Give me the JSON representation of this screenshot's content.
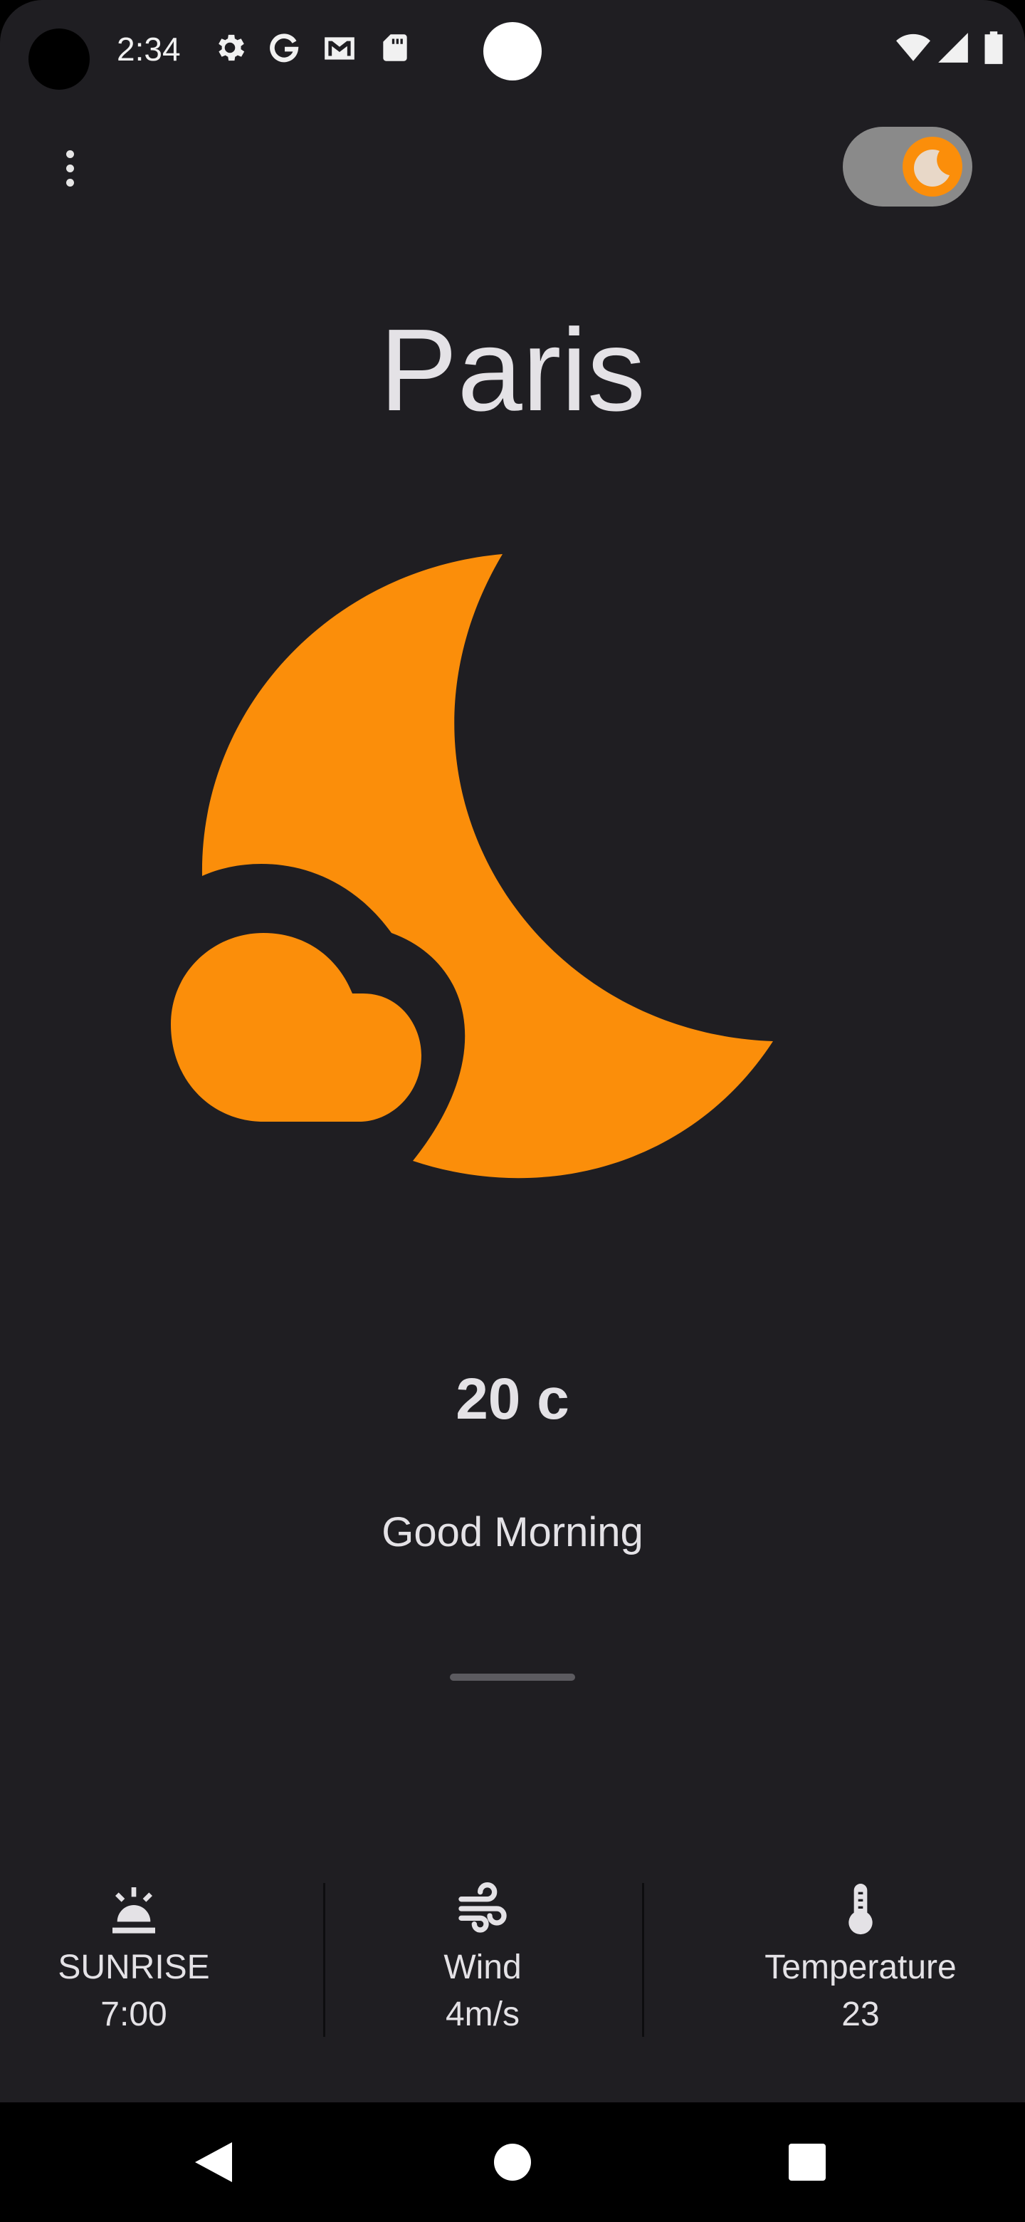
{
  "status_bar": {
    "time": "2:34",
    "icons": [
      "settings-icon",
      "google-icon",
      "gmail-icon",
      "sd-card-icon",
      "wifi-icon",
      "signal-icon",
      "battery-icon"
    ]
  },
  "top_bar": {
    "menu_icon": "more-vert-icon",
    "theme_toggle": {
      "state": "dark",
      "icon": "moon-cloud-icon"
    }
  },
  "weather": {
    "city": "Paris",
    "illustration": "moon-cloud-icon",
    "temperature": "20 c",
    "greeting": "Good Morning"
  },
  "details": [
    {
      "icon": "sunrise-icon",
      "label": "SUNRISE",
      "value": "7:00"
    },
    {
      "icon": "wind-icon",
      "label": "Wind",
      "value": "4m/s"
    },
    {
      "icon": "thermometer-icon",
      "label": "Temperature",
      "value": "23"
    }
  ],
  "navigation": {
    "back": "back-triangle-icon",
    "home": "home-circle-icon",
    "recents": "recents-square-icon"
  },
  "colors": {
    "background": "#1f1e22",
    "accent": "#fb8e0a",
    "text": "#e4e2e6",
    "toggle_track": "#8a8a8a"
  }
}
